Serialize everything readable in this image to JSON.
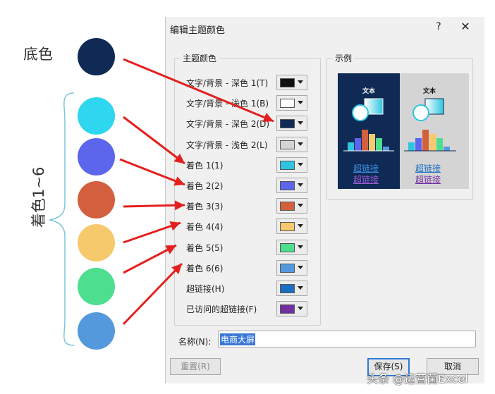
{
  "annotation": {
    "base_label": "底色",
    "accent_label": "着色1~6",
    "circles": [
      {
        "name": "base",
        "color": "#0f2a54"
      },
      {
        "name": "accent1",
        "color": "#2ed6f0"
      },
      {
        "name": "accent2",
        "color": "#5b66ec"
      },
      {
        "name": "accent3",
        "color": "#d2603f"
      },
      {
        "name": "accent4",
        "color": "#f7c96d"
      },
      {
        "name": "accent5",
        "color": "#4dde8f"
      },
      {
        "name": "accent6",
        "color": "#5599dd"
      }
    ],
    "arrow_color": "#e4201e",
    "bracket_color": "#7cc7d8"
  },
  "dialog": {
    "title": "编辑主题颜色",
    "help_label": "?",
    "close_label": "✕",
    "theme_colors_title": "主题颜色",
    "preview_title": "示例",
    "rows": [
      {
        "label": "文字/背景 - 深色 1(T)",
        "color": "#101010"
      },
      {
        "label": "文字/背景 - 浅色 1(B)",
        "color": "#ffffff"
      },
      {
        "label": "文字/背景 - 深色 2(D)",
        "color": "#0f2a54"
      },
      {
        "label": "文字/背景 - 浅色 2(L)",
        "color": "#d4d4d4"
      },
      {
        "label": "着色 1(1)",
        "color": "#2ec5e0"
      },
      {
        "label": "着色 2(2)",
        "color": "#5b66ec"
      },
      {
        "label": "着色 3(3)",
        "color": "#d2603f"
      },
      {
        "label": "着色 4(4)",
        "color": "#f7c96d"
      },
      {
        "label": "着色 5(5)",
        "color": "#4dde8f"
      },
      {
        "label": "着色 6(6)",
        "color": "#5599dd"
      },
      {
        "label": "超链接(H)",
        "color": "#1a6fc1"
      },
      {
        "label": "已访问的超链接(F)",
        "color": "#7030a0"
      }
    ],
    "preview": {
      "text_label": "文本",
      "hyperlink": "超链接",
      "visited_link": "超链接",
      "bar_values": [
        2,
        3,
        5,
        4,
        3,
        1
      ]
    },
    "name_label": "名称(N):",
    "name_value": "电商大屏",
    "reset_label": "重置(R)",
    "save_label": "保存(S)",
    "cancel_label": "取消"
  },
  "watermark": "头条 @运营菌Excel"
}
